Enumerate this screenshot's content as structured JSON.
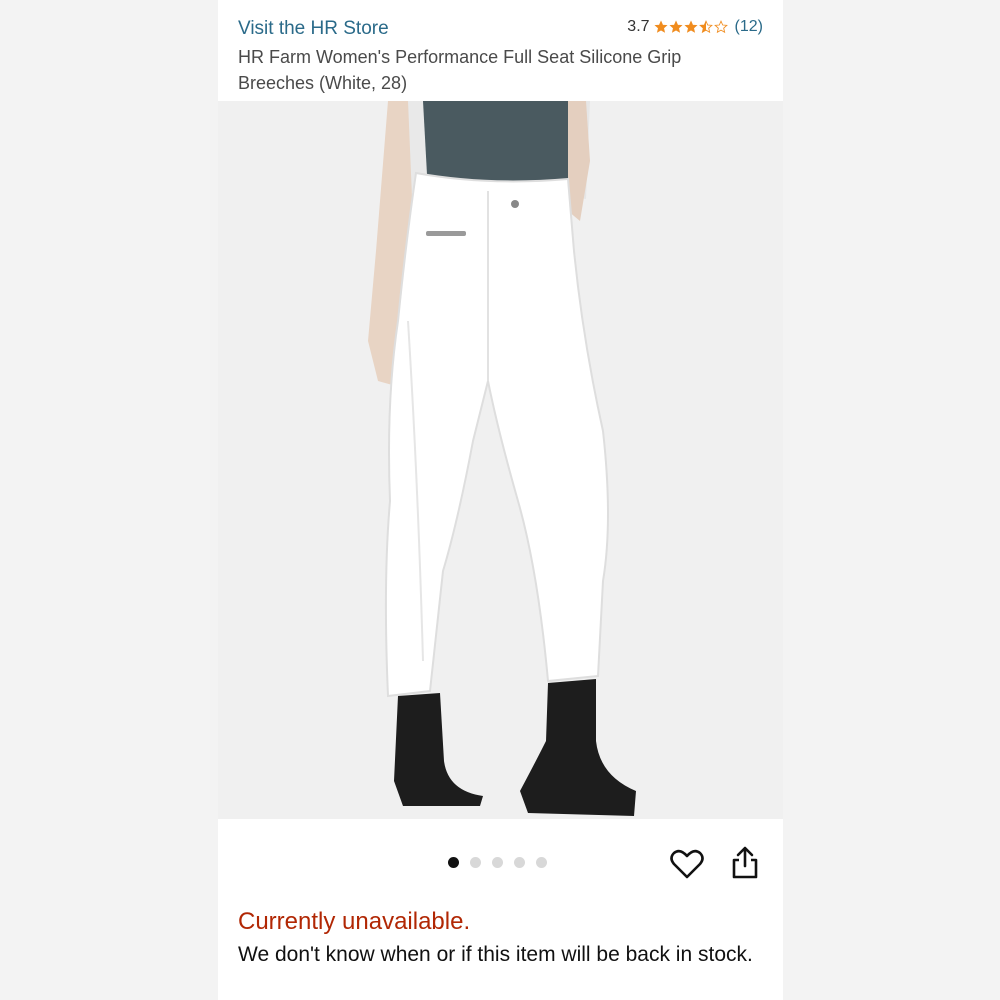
{
  "header": {
    "store_link": "Visit the HR Store",
    "rating_value": "3.7",
    "rating_stars": 3.7,
    "review_count": "(12)",
    "star_color": "#f08c1e"
  },
  "product": {
    "title": "HR Farm Women's Performance Full Seat Silicone Grip Breeches (White, 28)"
  },
  "carousel": {
    "total_images": 5,
    "active_index": 0
  },
  "icons": {
    "wishlist": "heart-icon",
    "share": "share-icon"
  },
  "availability": {
    "status": "Currently unavailable.",
    "status_color": "#b12704",
    "message": "We don't know when or if this item will be back in stock."
  }
}
